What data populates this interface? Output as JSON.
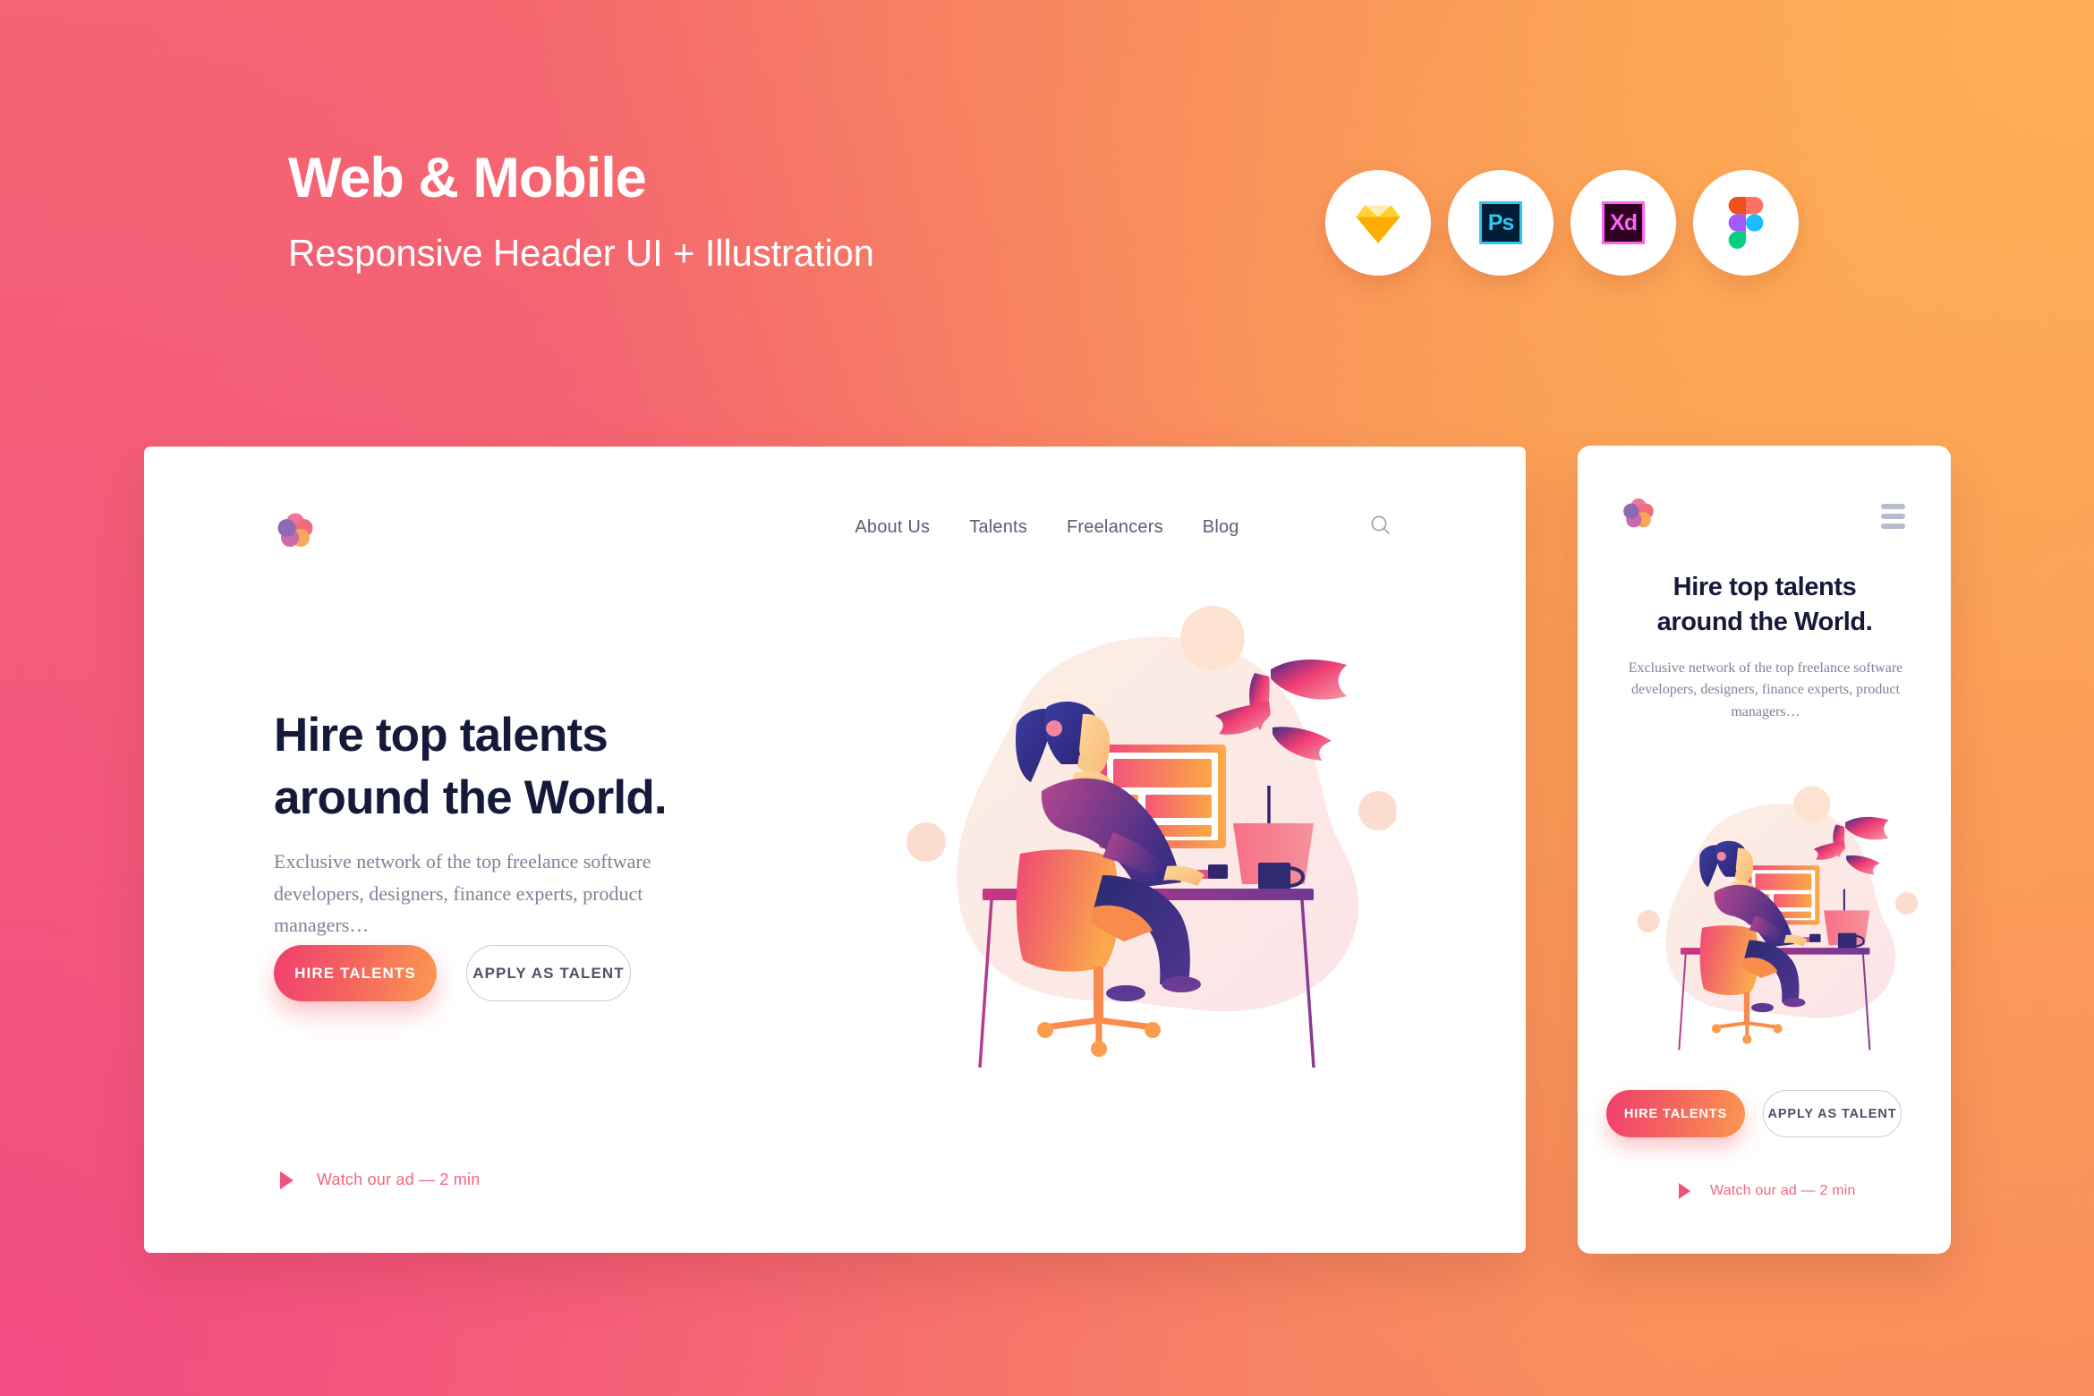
{
  "header": {
    "title": "Web & Mobile",
    "subtitle": "Responsive Header UI + Illustration",
    "app_icons": [
      {
        "name": "sketch-icon",
        "label": ""
      },
      {
        "name": "photoshop-icon",
        "label": "Ps"
      },
      {
        "name": "adobe-xd-icon",
        "label": "Xd"
      },
      {
        "name": "figma-icon",
        "label": ""
      }
    ]
  },
  "desktop": {
    "nav": {
      "links": [
        {
          "label": "About Us"
        },
        {
          "label": "Talents"
        },
        {
          "label": "Freelancers"
        },
        {
          "label": "Blog"
        }
      ],
      "search_icon": "search-icon",
      "logo_icon": "flower-logo-icon"
    },
    "hero": {
      "heading_line1": "Hire top talents",
      "heading_line2": "around the World.",
      "subtext": "Exclusive network of the top freelance software developers, designers, finance experts, product managers…",
      "primary_button": "HIRE TALENTS",
      "secondary_button": "APPLY AS TALENT",
      "watch_label": "Watch our ad — 2 min"
    }
  },
  "mobile": {
    "nav": {
      "logo_icon": "flower-logo-icon",
      "menu_icon": "hamburger-menu-icon"
    },
    "hero": {
      "heading_line1": "Hire top talents",
      "heading_line2": "around the World.",
      "subtext": "Exclusive network of the top freelance software developers, designers, finance experts, product managers…",
      "primary_button": "HIRE TALENTS",
      "secondary_button": "APPLY AS TALENT",
      "watch_label": "Watch our ad — 2 min"
    }
  },
  "colors": {
    "bg_top_left": "#f4686f",
    "bg_top_right": "#fdaf54",
    "bg_bottom_left": "#f24c84",
    "bg_bottom_right": "#f98a5e",
    "card_bg": "#ffffff",
    "heading": "#15193a",
    "body_text": "#7d8399",
    "nav_text": "#58607a",
    "accent_pink": "#ef3f6e",
    "accent_orange": "#fa9950",
    "watch_link": "#f4647f"
  }
}
